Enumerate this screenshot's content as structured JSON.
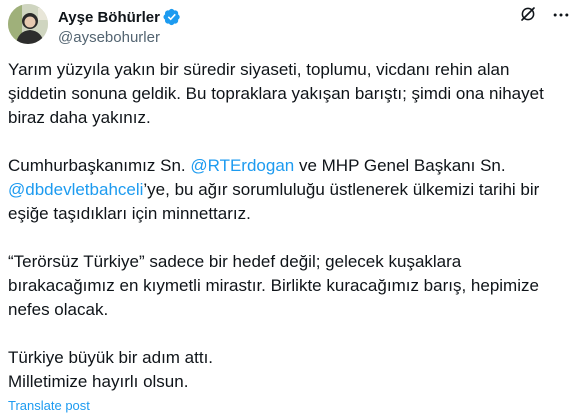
{
  "author": {
    "display_name": "Ayşe Böhürler",
    "handle": "@aysebohurler"
  },
  "colors": {
    "link": "#1d9bf0",
    "text": "#0f1419",
    "secondary": "#536471"
  },
  "icons": {
    "verified": "verified-badge-icon",
    "grok": "grok-icon",
    "more": "more-options-icon"
  },
  "tweet": {
    "p1": {
      "l1": "Yarım yüzyıla yakın bir süredir siyaseti, toplumu, vicdanı rehin alan",
      "l2": "şiddetin sonuna geldik. Bu topraklara yakışan barıştı; şimdi ona nihayet",
      "l3": "biraz daha yakınız."
    },
    "p2": {
      "l1_pre": "Cumhurbaşkanımız Sn. ",
      "mention1": "@RTErdogan",
      "l1_post": " ve MHP Genel Başkanı Sn.",
      "mention2": "@dbdevletbahceli",
      "l2_post": "’ye, bu ağır sorumluluğu üstlenerek ülkemizi tarihi bir",
      "l3": "eşiğe taşıdıkları için minnettarız."
    },
    "p3": {
      "l1": "“Terörsüz Türkiye” sadece bir hedef değil; gelecek kuşaklara",
      "l2": "bırakacağımız en kıymetli mirastır. Birlikte kuracağımız barış, hepimize",
      "l3": "nefes olacak."
    },
    "p4": {
      "l1": "Türkiye büyük bir adım attı.",
      "l2": "Milletimize hayırlı olsun."
    }
  },
  "translate_label": "Translate post"
}
